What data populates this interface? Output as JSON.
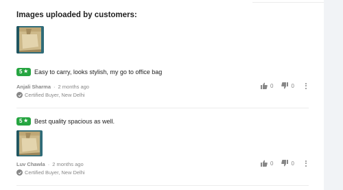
{
  "section_title": "Images uploaded by customers:",
  "colors": {
    "rating_badge": "#26a541",
    "muted_text": "#878787",
    "body_text": "#212121"
  },
  "reviews": [
    {
      "rating": "5",
      "text": "Easy to carry, looks stylish, my go to office bag",
      "author": "Anjali Sharma",
      "time": "2 months ago",
      "certified": "Certified Buyer, New Delhi",
      "likes": "0",
      "dislikes": "0"
    },
    {
      "rating": "5",
      "text": "Best quality spacious as well.",
      "author": "Luv Chawla",
      "time": "2 months ago",
      "certified": "Certified Buyer, New Delhi",
      "likes": "0",
      "dislikes": "0"
    }
  ],
  "icons": {
    "star": "star-icon",
    "like": "thumbs-up-icon",
    "dislike": "thumbs-down-icon",
    "more": "more-vertical-icon",
    "certified": "check-circle-icon"
  }
}
